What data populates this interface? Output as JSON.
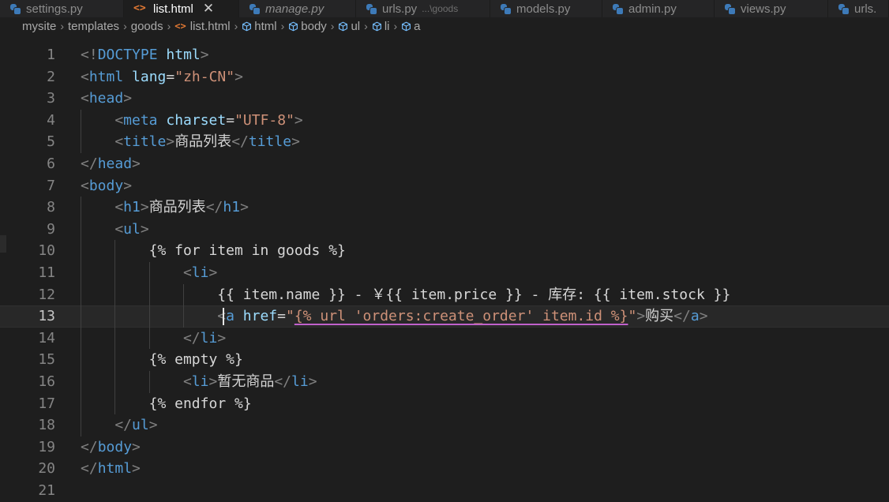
{
  "tabs": [
    {
      "label": "settings.py",
      "icon": "python-icon",
      "italic": false,
      "active": false
    },
    {
      "label": "list.html",
      "icon": "html-icon",
      "italic": false,
      "active": true
    },
    {
      "label": "manage.py",
      "icon": "python-icon",
      "italic": true,
      "active": false
    },
    {
      "label": "urls.py",
      "icon": "python-icon",
      "italic": false,
      "active": false,
      "desc": "...\\goods"
    },
    {
      "label": "models.py",
      "icon": "python-icon",
      "italic": false,
      "active": false
    },
    {
      "label": "admin.py",
      "icon": "python-icon",
      "italic": false,
      "active": false
    },
    {
      "label": "views.py",
      "icon": "python-icon",
      "italic": false,
      "active": false
    },
    {
      "label": "urls.",
      "icon": "python-icon",
      "italic": false,
      "active": false
    }
  ],
  "close_glyph": "✕",
  "breadcrumb": [
    {
      "label": "mysite",
      "icon": ""
    },
    {
      "label": "templates",
      "icon": ""
    },
    {
      "label": "goods",
      "icon": ""
    },
    {
      "label": "list.html",
      "icon": "html-icon"
    },
    {
      "label": "html",
      "icon": "cube-icon"
    },
    {
      "label": "body",
      "icon": "cube-icon"
    },
    {
      "label": "ul",
      "icon": "cube-icon"
    },
    {
      "label": "li",
      "icon": "cube-icon"
    },
    {
      "label": "a",
      "icon": "cube-icon"
    }
  ],
  "editor": {
    "current_line": 13,
    "lines": [
      {
        "n": "1",
        "indent": 0,
        "tokens": [
          [
            "p",
            "<!"
          ],
          [
            "t",
            "DOCTYPE"
          ],
          [
            "x",
            " "
          ],
          [
            "a",
            "html"
          ],
          [
            "p",
            ">"
          ]
        ]
      },
      {
        "n": "2",
        "indent": 0,
        "tokens": [
          [
            "p",
            "<"
          ],
          [
            "t",
            "html"
          ],
          [
            "x",
            " "
          ],
          [
            "a",
            "lang"
          ],
          [
            "x",
            "="
          ],
          [
            "s",
            "\"zh-CN\""
          ],
          [
            "p",
            ">"
          ]
        ]
      },
      {
        "n": "3",
        "indent": 0,
        "tokens": [
          [
            "p",
            "<"
          ],
          [
            "t",
            "head"
          ],
          [
            "p",
            ">"
          ]
        ]
      },
      {
        "n": "4",
        "indent": 1,
        "tokens": [
          [
            "p",
            "<"
          ],
          [
            "t",
            "meta"
          ],
          [
            "x",
            " "
          ],
          [
            "a",
            "charset"
          ],
          [
            "x",
            "="
          ],
          [
            "s",
            "\"UTF-8\""
          ],
          [
            "p",
            ">"
          ]
        ]
      },
      {
        "n": "5",
        "indent": 1,
        "tokens": [
          [
            "p",
            "<"
          ],
          [
            "t",
            "title"
          ],
          [
            "p",
            ">"
          ],
          [
            "x",
            "商品列表"
          ],
          [
            "p",
            "</"
          ],
          [
            "t",
            "title"
          ],
          [
            "p",
            ">"
          ]
        ]
      },
      {
        "n": "6",
        "indent": 0,
        "tokens": [
          [
            "p",
            "</"
          ],
          [
            "t",
            "head"
          ],
          [
            "p",
            ">"
          ]
        ]
      },
      {
        "n": "7",
        "indent": 0,
        "tokens": [
          [
            "p",
            "<"
          ],
          [
            "t",
            "body"
          ],
          [
            "p",
            ">"
          ]
        ]
      },
      {
        "n": "8",
        "indent": 1,
        "tokens": [
          [
            "p",
            "<"
          ],
          [
            "t",
            "h1"
          ],
          [
            "p",
            ">"
          ],
          [
            "x",
            "商品列表"
          ],
          [
            "p",
            "</"
          ],
          [
            "t",
            "h1"
          ],
          [
            "p",
            ">"
          ]
        ]
      },
      {
        "n": "9",
        "indent": 1,
        "tokens": [
          [
            "p",
            "<"
          ],
          [
            "t",
            "ul"
          ],
          [
            "p",
            ">"
          ]
        ]
      },
      {
        "n": "10",
        "indent": 2,
        "tokens": [
          [
            "tpl",
            "{% for item in goods %}"
          ]
        ]
      },
      {
        "n": "11",
        "indent": 3,
        "tokens": [
          [
            "p",
            "<"
          ],
          [
            "t",
            "li"
          ],
          [
            "p",
            ">"
          ]
        ]
      },
      {
        "n": "12",
        "indent": 4,
        "tokens": [
          [
            "tpl",
            "{{ item.name }} - ￥{{ item.price }} - 库存: {{ item.stock }}"
          ]
        ]
      },
      {
        "n": "13",
        "indent": 4,
        "tokens": [
          [
            "p",
            "<"
          ],
          [
            "t",
            "a"
          ],
          [
            "x",
            " "
          ],
          [
            "a",
            "href"
          ],
          [
            "x",
            "="
          ],
          [
            "s",
            "\""
          ],
          [
            "su",
            "{% url 'orders:create_order' item.id %}"
          ],
          [
            "s",
            "\""
          ],
          [
            "p",
            ">"
          ],
          [
            "x",
            "购买"
          ],
          [
            "p",
            "</"
          ],
          [
            "t",
            "a"
          ],
          [
            "p",
            ">"
          ]
        ]
      },
      {
        "n": "14",
        "indent": 3,
        "tokens": [
          [
            "p",
            "</"
          ],
          [
            "t",
            "li"
          ],
          [
            "p",
            ">"
          ]
        ]
      },
      {
        "n": "15",
        "indent": 2,
        "tokens": [
          [
            "tpl",
            "{% empty %}"
          ]
        ]
      },
      {
        "n": "16",
        "indent": 3,
        "tokens": [
          [
            "p",
            "<"
          ],
          [
            "t",
            "li"
          ],
          [
            "p",
            ">"
          ],
          [
            "x",
            "暂无商品"
          ],
          [
            "p",
            "</"
          ],
          [
            "t",
            "li"
          ],
          [
            "p",
            ">"
          ]
        ]
      },
      {
        "n": "17",
        "indent": 2,
        "tokens": [
          [
            "tpl",
            "{% endfor %}"
          ]
        ]
      },
      {
        "n": "18",
        "indent": 1,
        "tokens": [
          [
            "p",
            "</"
          ],
          [
            "t",
            "ul"
          ],
          [
            "p",
            ">"
          ]
        ]
      },
      {
        "n": "19",
        "indent": 0,
        "tokens": [
          [
            "p",
            "</"
          ],
          [
            "t",
            "body"
          ],
          [
            "p",
            ">"
          ]
        ]
      },
      {
        "n": "20",
        "indent": 0,
        "tokens": [
          [
            "p",
            "</"
          ],
          [
            "t",
            "html"
          ],
          [
            "p",
            ">"
          ]
        ]
      },
      {
        "n": "21",
        "indent": 0,
        "tokens": []
      }
    ]
  }
}
